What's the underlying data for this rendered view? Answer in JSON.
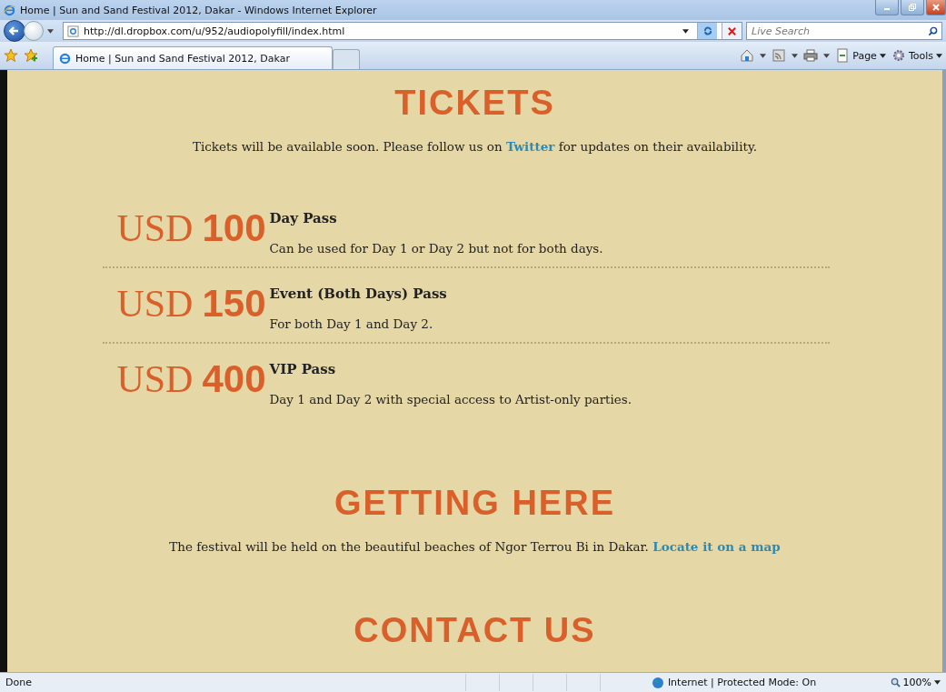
{
  "window": {
    "title": "Home | Sun and Sand Festival 2012, Dakar - Windows Internet Explorer"
  },
  "address_bar": {
    "url": "http://dl.dropbox.com/u/952/audiopolyfill/index.html"
  },
  "search": {
    "placeholder": "Live Search"
  },
  "tabs": [
    {
      "label": "Home | Sun and Sand Festival 2012, Dakar",
      "selected": true
    }
  ],
  "command_bar": [
    "Page",
    "Tools"
  ],
  "page": {
    "tickets_heading": "TICKETS",
    "tickets_intro": {
      "before": "Tickets will be available soon. Please follow us on ",
      "link": "Twitter",
      "after": " for updates on their availability."
    },
    "passes": [
      {
        "currency": "USD",
        "amount": "100",
        "name": "Day Pass",
        "description": "Can be used for Day 1 or Day 2 but not for both days."
      },
      {
        "currency": "USD",
        "amount": "150",
        "name": "Event (Both Days) Pass",
        "description": "For both Day 1 and Day 2."
      },
      {
        "currency": "USD",
        "amount": "400",
        "name": "VIP Pass",
        "description": "Day 1 and Day 2 with special access to Artist-only parties."
      }
    ],
    "getting_here_heading": "GETTING HERE",
    "getting_here_text": {
      "before": "The festival will be held on the beautiful beaches of Ngor Terrou Bi in Dakar. ",
      "link": "Locate it on a map"
    },
    "contact_heading": "CONTACT US"
  },
  "status_bar": {
    "status": "Done",
    "zone": "Internet | Protected Mode: On",
    "zoom": "100%"
  }
}
